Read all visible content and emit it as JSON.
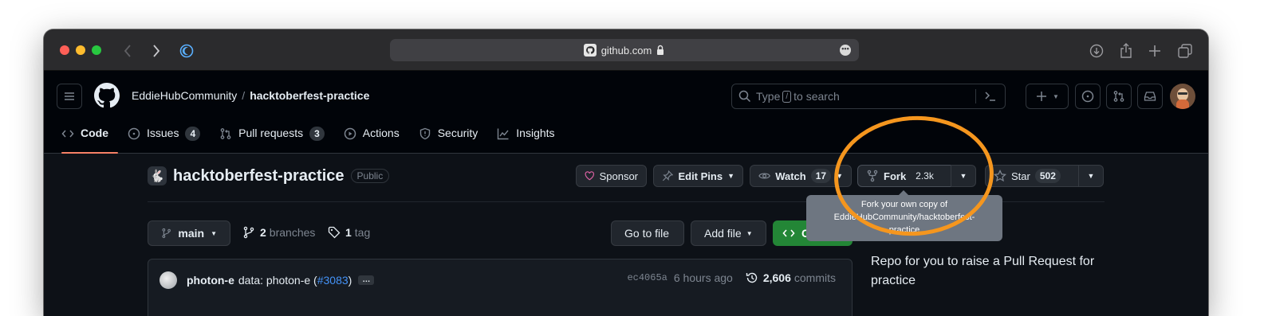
{
  "browser": {
    "url": "github.com",
    "traffic_lights": {
      "close": "#fe5f57",
      "minimize": "#febc2e",
      "maximize": "#28c840"
    }
  },
  "header": {
    "owner": "EddieHubCommunity",
    "separator": "/",
    "repo": "hacktoberfest-practice",
    "search": {
      "prefix": "Type",
      "key": "/",
      "suffix": "to search"
    }
  },
  "tabs": [
    {
      "label": "Code",
      "icon": "code-icon",
      "active": true
    },
    {
      "label": "Issues",
      "icon": "issue-icon",
      "count": "4"
    },
    {
      "label": "Pull requests",
      "icon": "pull-request-icon",
      "count": "3"
    },
    {
      "label": "Actions",
      "icon": "play-icon"
    },
    {
      "label": "Security",
      "icon": "shield-icon"
    },
    {
      "label": "Insights",
      "icon": "graph-icon"
    }
  ],
  "repo_header": {
    "name": "hacktoberfest-practice",
    "visibility": "Public",
    "sponsor": "Sponsor",
    "edit_pins": "Edit Pins",
    "watch": {
      "label": "Watch",
      "count": "17"
    },
    "fork": {
      "label": "Fork",
      "count": "2.3k"
    },
    "star": {
      "label": "Star",
      "count": "502"
    }
  },
  "tooltip": {
    "lines": [
      "Fork your own copy of",
      "EddieHubCommunity/hacktoberfest-",
      "practice"
    ]
  },
  "file_nav": {
    "branch": "main",
    "branches": {
      "count": "2",
      "label": "branches"
    },
    "tags": {
      "count": "1",
      "label": "tag"
    },
    "go_to_file": "Go to file",
    "add_file": "Add file",
    "code": "C"
  },
  "commit": {
    "author": "photon-e",
    "message": "data: photon-e (",
    "pr_link": "#3083",
    "message_end": ")",
    "ellipsis": "…",
    "sha": "ec4065a",
    "time": "6 hours ago",
    "commit_count": "2,606",
    "commit_label": "commits"
  },
  "about": {
    "description": "Repo for you to raise a Pull Request for practice"
  },
  "colors": {
    "accent_tab_underline": "#f78166",
    "link": "#4493f8",
    "code_button": "#238636",
    "annotation_ring": "#f5961e",
    "sponsor_heart": "#db61a2"
  }
}
